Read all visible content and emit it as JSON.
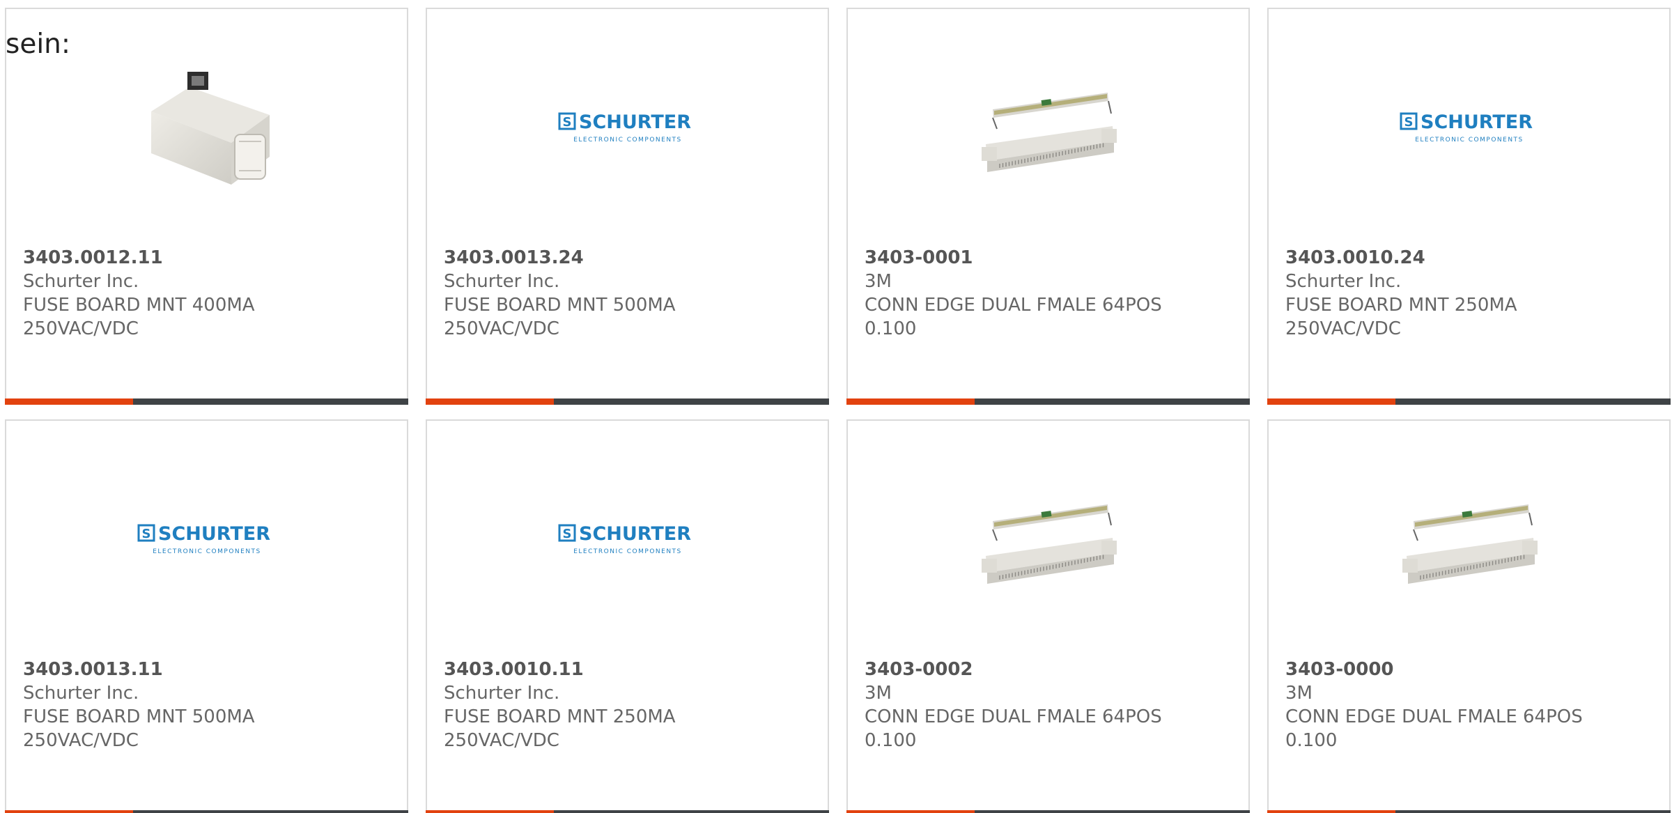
{
  "intro_text": "sein:",
  "colors": {
    "accent": "#e2420f",
    "bar": "#3f4346",
    "brand_blue": "#1f7fc0"
  },
  "logo": {
    "name": "SCHURTER",
    "tagline": "ELECTRONIC COMPONENTS"
  },
  "products": [
    {
      "part_number": "3403.0012.11",
      "manufacturer": "Schurter Inc.",
      "desc1": "FUSE BOARD MNT 400MA",
      "desc2": "250VAC/VDC",
      "image": "fuse-photo"
    },
    {
      "part_number": "3403.0013.24",
      "manufacturer": "Schurter Inc.",
      "desc1": "FUSE BOARD MNT 500MA",
      "desc2": "250VAC/VDC",
      "image": "schurter-logo"
    },
    {
      "part_number": "3403-0001",
      "manufacturer": "3M",
      "desc1": "CONN EDGE DUAL FMALE 64POS",
      "desc2": "0.100",
      "image": "connector-photo"
    },
    {
      "part_number": "3403.0010.24",
      "manufacturer": "Schurter Inc.",
      "desc1": "FUSE BOARD MNT 250MA",
      "desc2": "250VAC/VDC",
      "image": "schurter-logo"
    },
    {
      "part_number": "3403.0013.11",
      "manufacturer": "Schurter Inc.",
      "desc1": "FUSE BOARD MNT 500MA",
      "desc2": "250VAC/VDC",
      "image": "schurter-logo"
    },
    {
      "part_number": "3403.0010.11",
      "manufacturer": "Schurter Inc.",
      "desc1": "FUSE BOARD MNT 250MA",
      "desc2": "250VAC/VDC",
      "image": "schurter-logo"
    },
    {
      "part_number": "3403-0002",
      "manufacturer": "3M",
      "desc1": "CONN EDGE DUAL FMALE 64POS",
      "desc2": "0.100",
      "image": "connector-photo"
    },
    {
      "part_number": "3403-0000",
      "manufacturer": "3M",
      "desc1": "CONN EDGE DUAL FMALE 64POS",
      "desc2": "0.100",
      "image": "connector-photo"
    }
  ]
}
